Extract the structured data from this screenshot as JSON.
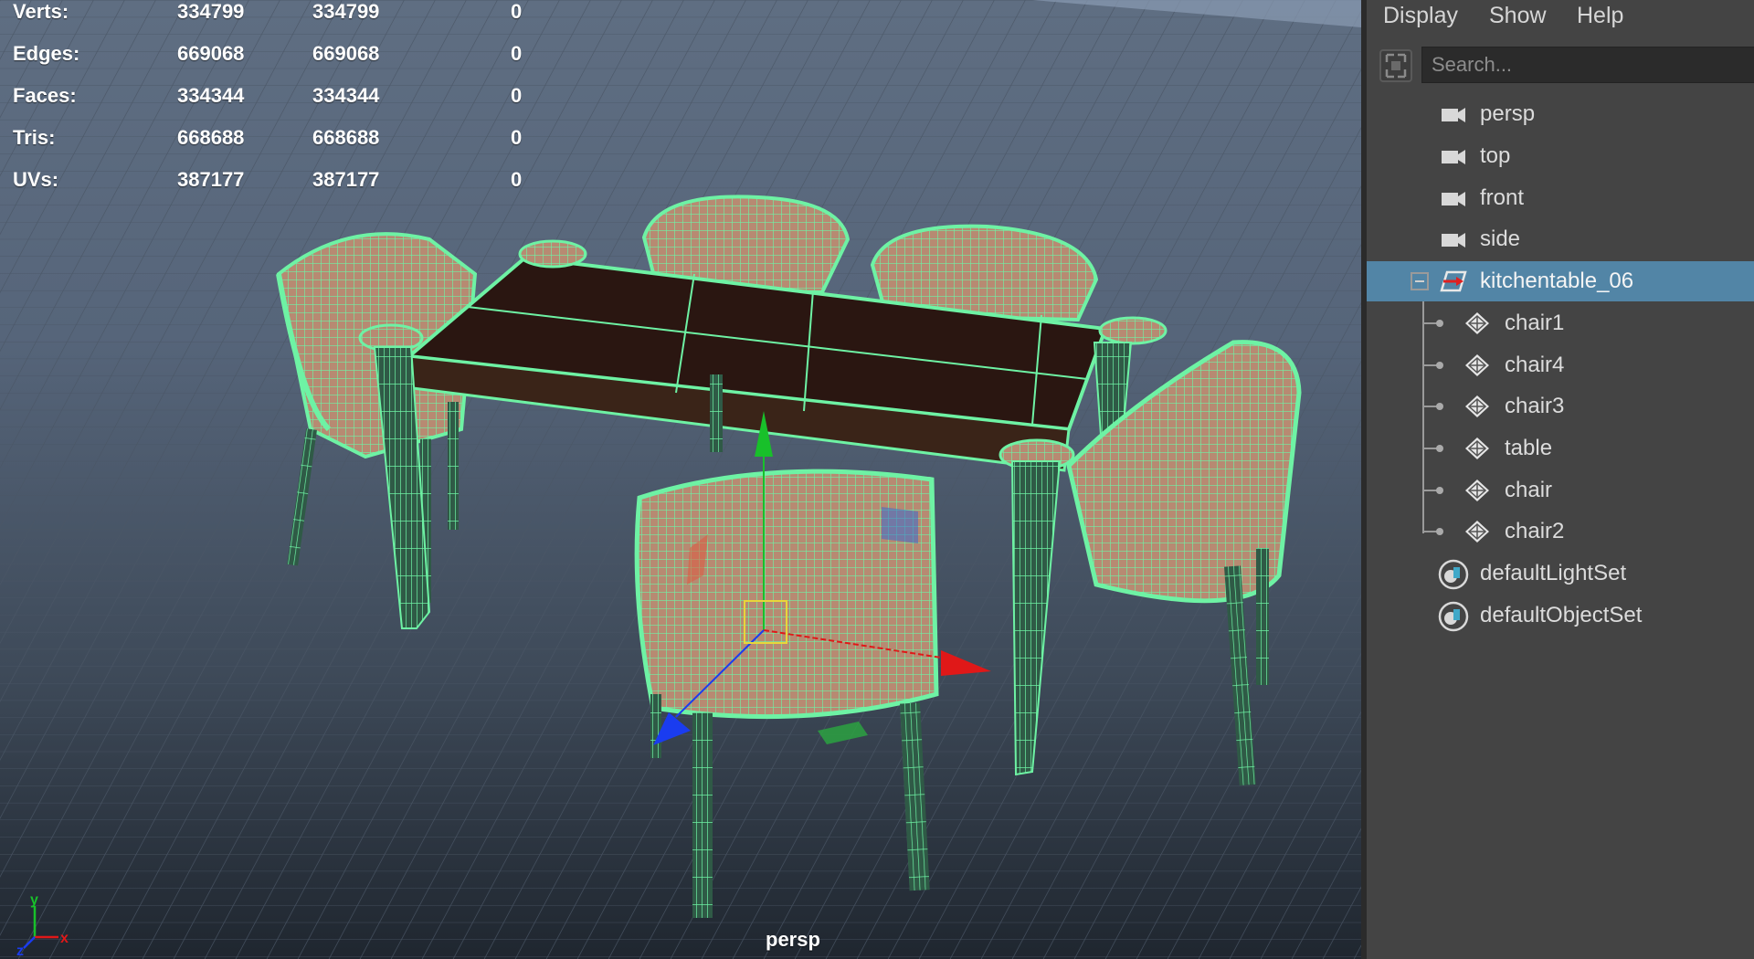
{
  "viewport": {
    "camera_label": "persp",
    "stats": [
      {
        "label": "Verts:",
        "v1": "334799",
        "v2": "334799",
        "v3": "0"
      },
      {
        "label": "Edges:",
        "v1": "669068",
        "v2": "669068",
        "v3": "0"
      },
      {
        "label": "Faces:",
        "v1": "334344",
        "v2": "334344",
        "v3": "0"
      },
      {
        "label": "Tris:",
        "v1": "668688",
        "v2": "668688",
        "v3": "0"
      },
      {
        "label": "UVs:",
        "v1": "387177",
        "v2": "387177",
        "v3": "0"
      }
    ],
    "axis": {
      "x": "x",
      "y": "y",
      "z": "z"
    },
    "colors": {
      "wireframe": "#6ef2a4",
      "tabletop": "#2a1611",
      "gizmo_x": "#e01818",
      "gizmo_y": "#18c02a",
      "gizmo_z": "#1a3cf0"
    }
  },
  "outliner": {
    "menu": [
      "Display",
      "Show",
      "Help"
    ],
    "search_placeholder": "Search...",
    "items": [
      {
        "label": "persp",
        "icon": "camera-icon"
      },
      {
        "label": "top",
        "icon": "camera-icon"
      },
      {
        "label": "front",
        "icon": "camera-icon"
      },
      {
        "label": "side",
        "icon": "camera-icon"
      },
      {
        "label": "kitchentable_06",
        "icon": "group-transform-icon",
        "selected": true
      },
      {
        "label": "chair1",
        "icon": "mesh-icon"
      },
      {
        "label": "chair4",
        "icon": "mesh-icon"
      },
      {
        "label": "chair3",
        "icon": "mesh-icon"
      },
      {
        "label": "table",
        "icon": "mesh-icon"
      },
      {
        "label": "chair",
        "icon": "mesh-icon"
      },
      {
        "label": "chair2",
        "icon": "mesh-icon"
      },
      {
        "label": "defaultLightSet",
        "icon": "set-icon"
      },
      {
        "label": "defaultObjectSet",
        "icon": "set-icon"
      }
    ],
    "selected_color": "#5285a6"
  }
}
